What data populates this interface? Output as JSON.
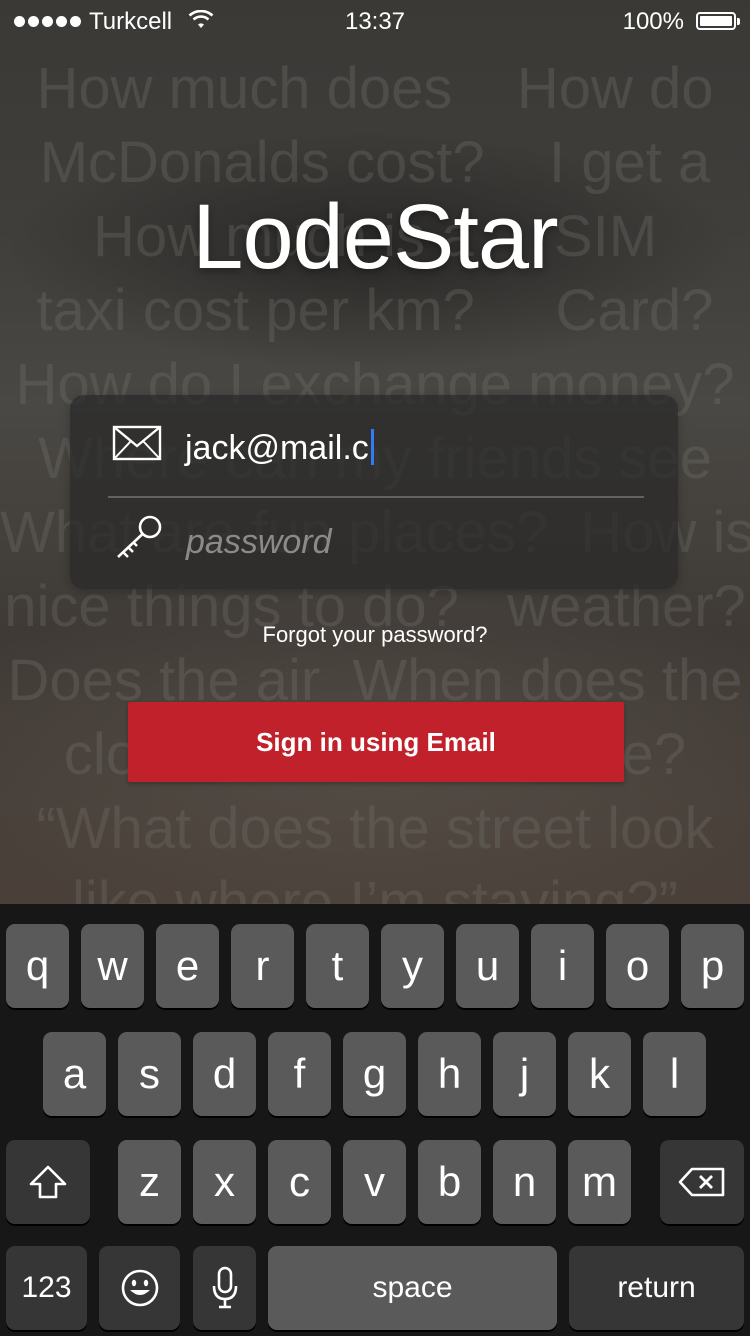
{
  "status_bar": {
    "carrier": "Turkcell",
    "time": "13:37",
    "battery_percent": "100%"
  },
  "background": {
    "text": "How much does    How do\nMcDonalds cost?    I get a\nHow much is a     SIM\ntaxi cost per km?     Card?\nHow do I exchange money?\nWhere can my friends see\nWhat are fun places?  How is the\nnice things to do?   weather?\nDoes the air  When does the\nclose?   museum close?\n“What does the street look\nlike where I’m staying?”"
  },
  "app": {
    "title": "LodeStar"
  },
  "login": {
    "email_value": "jack@mail.c",
    "password_placeholder": "password",
    "forgot_label": "Forgot your password?",
    "signin_label": "Sign in using Email"
  },
  "keyboard": {
    "row1": [
      "q",
      "w",
      "e",
      "r",
      "t",
      "y",
      "u",
      "i",
      "o",
      "p"
    ],
    "row2": [
      "a",
      "s",
      "d",
      "f",
      "g",
      "h",
      "j",
      "k",
      "l"
    ],
    "row3": [
      "z",
      "x",
      "c",
      "v",
      "b",
      "n",
      "m"
    ],
    "numbers_label": "123",
    "space_label": "space",
    "return_label": "return"
  },
  "icons": {
    "email": "envelope-icon",
    "password": "key-icon",
    "shift": "shift-arrow-icon",
    "delete": "backspace-icon",
    "emoji": "emoji-icon",
    "mic": "microphone-icon"
  },
  "colors": {
    "accent_button": "#c0212a",
    "caret": "#2f7cf6"
  }
}
